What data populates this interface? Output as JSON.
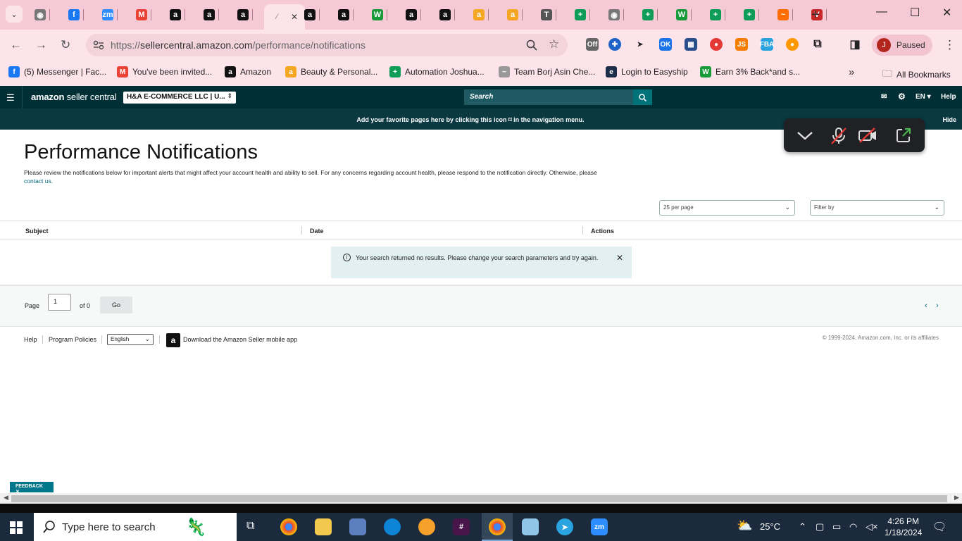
{
  "browser": {
    "tabs": [
      {
        "fav": "chrome",
        "color": "#777777"
      },
      {
        "fav": "f",
        "color": "#1877f2"
      },
      {
        "fav": "zm",
        "color": "#2d8cff"
      },
      {
        "fav": "M",
        "color": "#ea4335"
      },
      {
        "fav": "a",
        "color": "#111111"
      },
      {
        "fav": "a",
        "color": "#111111"
      },
      {
        "fav": "a",
        "color": "#111111"
      },
      {
        "fav": "a",
        "color": "#111111"
      },
      {
        "fav": "a",
        "color": "#111111"
      },
      {
        "fav": "W",
        "color": "#1a9b3a"
      },
      {
        "fav": "a",
        "color": "#111111"
      },
      {
        "fav": "a",
        "color": "#111111"
      },
      {
        "fav": "a",
        "color": "#f5a623"
      },
      {
        "fav": "a",
        "color": "#f5a623"
      },
      {
        "fav": "T",
        "color": "#555555"
      },
      {
        "fav": "+",
        "color": "#0f9d58"
      },
      {
        "fav": "globe",
        "color": "#777777"
      },
      {
        "fav": "+",
        "color": "#0f9d58"
      },
      {
        "fav": "W",
        "color": "#1a9b3a"
      },
      {
        "fav": "+",
        "color": "#0f9d58"
      },
      {
        "fav": "+",
        "color": "#0f9d58"
      },
      {
        "fav": "~",
        "color": "#ff6d00"
      },
      {
        "fav": "V",
        "color": "#c62828"
      }
    ],
    "url_prefix": "https://",
    "url_host": "sellercentral.amazon.com",
    "url_path": "/performance/notifications",
    "profile_initial": "J",
    "profile_status": "Paused",
    "bookmarks": [
      {
        "label": "(5) Messenger | Fac...",
        "icon": "f",
        "color": "#1877f2"
      },
      {
        "label": "You've been invited...",
        "icon": "M",
        "color": "#ea4335"
      },
      {
        "label": "Amazon",
        "icon": "a",
        "color": "#111111"
      },
      {
        "label": "Beauty & Personal...",
        "icon": "a",
        "color": "#f5a623"
      },
      {
        "label": "Automation Joshua...",
        "icon": "+",
        "color": "#0f9d58"
      },
      {
        "label": "Team Borj Asin Che...",
        "icon": "~",
        "color": "#999999"
      },
      {
        "label": "Login to Easyship",
        "icon": "e",
        "color": "#1c2e4a"
      },
      {
        "label": "Earn 3% Back*and s...",
        "icon": "W",
        "color": "#1a9b3a"
      }
    ],
    "all_bookmarks": "All Bookmarks"
  },
  "seller_central": {
    "logo_bold": "amazon",
    "logo_thin": " seller central",
    "account": "H&A E-COMMERCE LLC | U...",
    "search_placeholder": "Search",
    "lang": "EN",
    "help": "Help",
    "fav_message": "Add your favorite pages here by clicking this icon ⌑ in the navigation menu.",
    "hide": "Hide"
  },
  "page": {
    "title": "Performance Notifications",
    "desc": "Please review the notifications below for important alerts that might affect your account health and ability to sell. For any concerns regarding account health, please respond to the notification directly. Otherwise, please",
    "contact": "contact us.",
    "per_page": "25 per page",
    "filter": "Filter by",
    "columns": [
      "Subject",
      "Date",
      "Actions"
    ],
    "alert": "Your search returned no results. Please change your search parameters and try again.",
    "pager": {
      "label": "Page",
      "value": "1",
      "of": "of 0",
      "go": "Go"
    },
    "footer": {
      "help": "Help",
      "policies": "Program Policies",
      "lang": "English",
      "app": "Download the Amazon Seller mobile app",
      "copyright": "© 1999-2024, Amazon.com, Inc. or its affiliates"
    },
    "feedback": "FEEDBACK"
  },
  "taskbar": {
    "search_placeholder": "Type here to search",
    "weather": "25°C",
    "time": "4:26 PM",
    "date": "1/18/2024"
  }
}
